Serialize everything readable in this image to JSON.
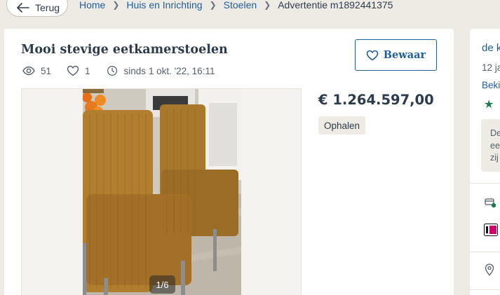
{
  "nav": {
    "back_label": "Terug",
    "breadcrumbs": [
      "Home",
      "Huis en Inrichting",
      "Stoelen"
    ],
    "current": "Advertentie m1892441375"
  },
  "listing": {
    "title": "Mooi stevige eetkamerstoelen",
    "views": "51",
    "favorites": "1",
    "since": "sinds 1 okt. '22, 16:11",
    "save_label": "Bewaar",
    "price": "€ 1.264.597,00",
    "delivery": "Ophalen",
    "photo_counter": "1/6"
  },
  "seller": {
    "name": "de k",
    "date": "12 ja",
    "link": "Beki",
    "note_lines": [
      "De",
      "ee",
      "zij"
    ]
  },
  "colors": {
    "link": "#1f5e9c",
    "text": "#2d3c4d",
    "background": "#eeeae4",
    "star": "#1d7a4e"
  },
  "icons": [
    "arrow-left-icon",
    "chevron-right-icon",
    "eye-icon",
    "heart-icon",
    "clock-icon",
    "star-icon",
    "payment-check-icon",
    "ideal-icon",
    "location-pin-icon"
  ]
}
